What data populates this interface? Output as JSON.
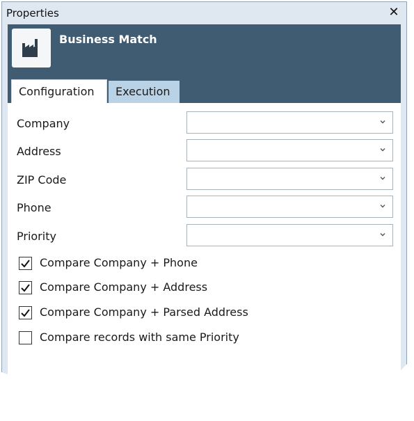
{
  "window": {
    "title": "Properties",
    "close_symbol": "✕"
  },
  "header": {
    "app_name": "Business Match",
    "app_icon": "factory-icon"
  },
  "tabs": [
    {
      "label": "Configuration",
      "active": true
    },
    {
      "label": "Execution",
      "active": false
    }
  ],
  "fields": [
    {
      "label": "Company",
      "value": ""
    },
    {
      "label": "Address",
      "value": ""
    },
    {
      "label": "ZIP Code",
      "value": ""
    },
    {
      "label": "Phone",
      "value": ""
    },
    {
      "label": "Priority",
      "value": ""
    }
  ],
  "options": [
    {
      "label": "Compare Company + Phone",
      "checked": true
    },
    {
      "label": "Compare Company + Address",
      "checked": true
    },
    {
      "label": "Compare Company + Parsed Address",
      "checked": true
    },
    {
      "label": "Compare records with same Priority",
      "checked": false
    }
  ],
  "colors": {
    "header_bg": "#3f5c73",
    "window_bg": "#dfe7f1",
    "inactive_tab": "#b9d2e6"
  }
}
